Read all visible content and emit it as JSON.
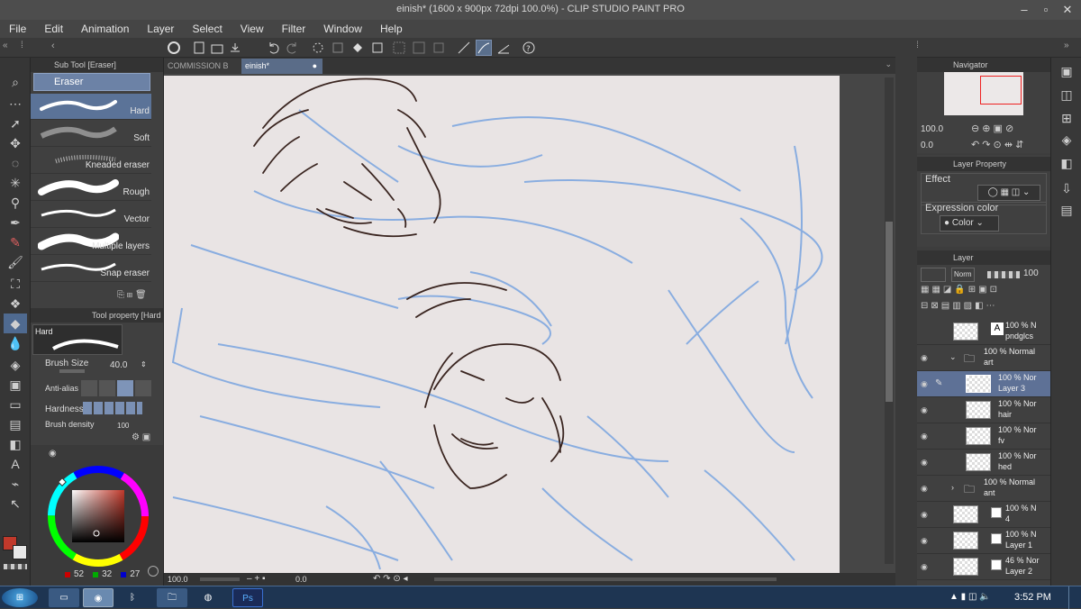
{
  "window": {
    "title": "einish* (1600 x 900px 72dpi 100.0%) - CLIP STUDIO PAINT PRO"
  },
  "menu": [
    "File",
    "Edit",
    "Animation",
    "Layer",
    "Select",
    "View",
    "Filter",
    "Window",
    "Help"
  ],
  "subtool": {
    "header": "Sub Tool [Eraser]",
    "group": "Eraser",
    "brushes": [
      {
        "label": "Hard",
        "selected": true
      },
      {
        "label": "Soft"
      },
      {
        "label": "Kneaded eraser"
      },
      {
        "label": "Rough"
      },
      {
        "label": "Vector"
      },
      {
        "label": "Multiple layers"
      },
      {
        "label": "Snap eraser"
      }
    ]
  },
  "tool_property": {
    "header": "Tool property [Hard",
    "preset": "Hard",
    "brush_size_label": "Brush Size",
    "brush_size_value": "40.0",
    "anti_alias_label": "Anti-alias",
    "hardness_label": "Hardness",
    "density_label": "Brush density",
    "density_value": "100"
  },
  "color": {
    "main": "#c0392b",
    "r": "52",
    "g": "32",
    "b": "27"
  },
  "tabs": [
    {
      "label": "COMMISSION B"
    },
    {
      "label": "einish*",
      "active": true
    }
  ],
  "status": {
    "zoom": "100.0",
    "angle": "0.0"
  },
  "navigator": {
    "title": "Navigator",
    "zoom": "100.0",
    "angle": "0.0"
  },
  "layer_property": {
    "title": "Layer Property",
    "effect_label": "Effect",
    "expression_label": "Expression color",
    "expression_value": "Color"
  },
  "layer_panel": {
    "title": "Layer",
    "blend": "Norm",
    "opacity": "100",
    "layers": [
      {
        "l1": "100 % N",
        "l2": "pndglcs",
        "kind": "text"
      },
      {
        "l1": "100 % Normal",
        "l2": "art",
        "kind": "folder"
      },
      {
        "l1": "100 % Nor",
        "l2": "Layer 3",
        "kind": "raster",
        "selected": true
      },
      {
        "l1": "100 % Nor",
        "l2": "hair",
        "kind": "raster"
      },
      {
        "l1": "100 % Nor",
        "l2": "fv",
        "kind": "raster"
      },
      {
        "l1": "100 % Nor",
        "l2": "hed",
        "kind": "raster"
      },
      {
        "l1": "100 % Normal",
        "l2": "ant",
        "kind": "folder-closed"
      },
      {
        "l1": "100 % N",
        "l2": "4",
        "kind": "raster2"
      },
      {
        "l1": "100 % N",
        "l2": "Layer 1",
        "kind": "raster2"
      },
      {
        "l1": "46 % Nor",
        "l2": "Layer 2",
        "kind": "raster2"
      }
    ]
  },
  "taskbar": {
    "time": "3:52 PM",
    "apps": [
      "explorer",
      "clip-studio",
      "bluetooth",
      "folder",
      "firefox",
      "photoshop"
    ],
    "ps_label": "Ps"
  }
}
